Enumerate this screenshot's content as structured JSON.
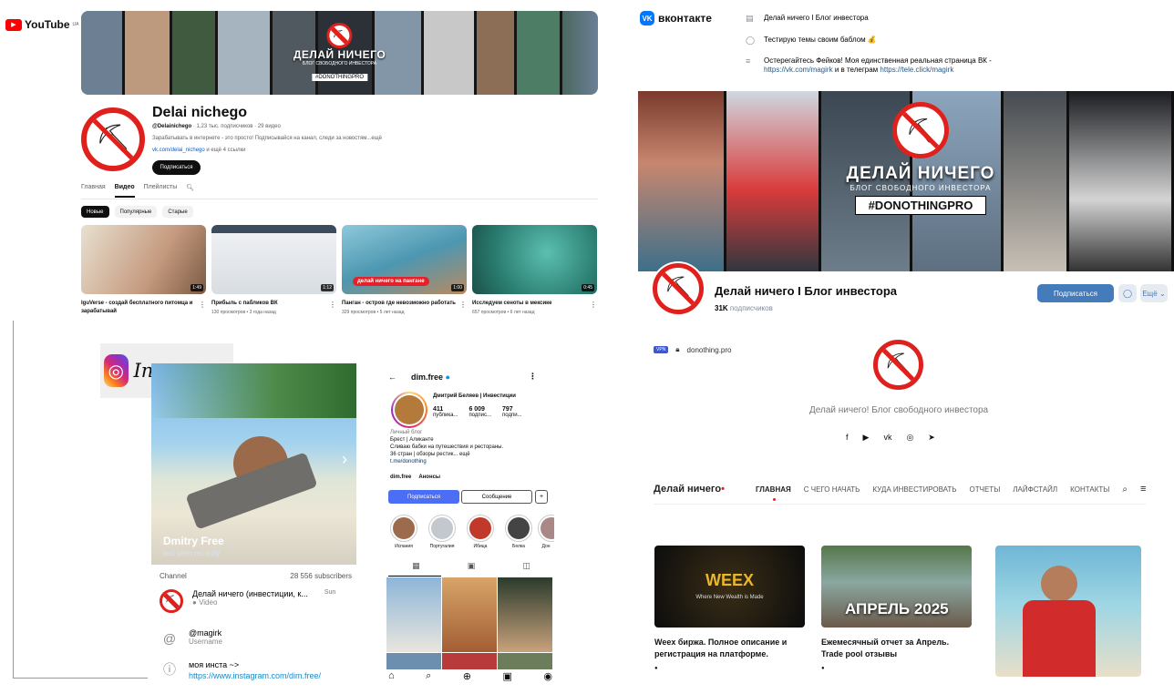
{
  "youtube": {
    "logo": "YouTube",
    "logo_suffix": "UA",
    "banner": {
      "title": "ДЕЛАЙ НИЧЕГО",
      "subtitle": "БЛОГ СВОБОДНОГО ИНВЕСТОРА",
      "tag": "#DONOTHINGPRO"
    },
    "channel_name": "Delai nichego",
    "handle": "@Delainichego",
    "meta": "1,23 тыс. подписчиков · 29 видео",
    "description": "Зарабатывать в интернете - это просто! Подписывайся на канал, следи за новостям...ещё",
    "link": "vk.com/delai_nichego",
    "link_more": "и ещё 4 ссылки",
    "subscribe": "Подписаться",
    "tabs": [
      "Главная",
      "Видео",
      "Плейлисты"
    ],
    "chips": [
      "Новые",
      "Популярные",
      "Старые"
    ],
    "videos": [
      {
        "title": "IguVerse - создай бесплатного питомца и зарабатывай",
        "meta": "",
        "duration": "1:49",
        "thumb_color": "#c9ac97"
      },
      {
        "title": "Прибыль с пабликов ВК",
        "meta": "130 просмотров • 3 года назад",
        "duration": "1:12",
        "thumb_color": "#d5d9de"
      },
      {
        "title": "Панган - остров где невозможно работать",
        "meta": "329 просмотров • 5 лет назад",
        "duration": "1:00",
        "overlay": "делай ничего на пангане",
        "thumb_color": "#5b9fb9"
      },
      {
        "title": "Исследуем сеноты в мексике",
        "meta": "657 просмотров • 6 лет назад",
        "duration": "0:45",
        "thumb_color": "#2d8a7c"
      }
    ]
  },
  "vk": {
    "logo": "вконтакте",
    "info": [
      {
        "icon": "doc-icon",
        "text": "Делай ничего I Блог инвестора"
      },
      {
        "icon": "chat-icon",
        "text": "Тестирую темы своим баблом 💰"
      },
      {
        "icon": "lines-icon",
        "text": "Остерегайтесь Фейков! Моя единственная реальная страница ВК -",
        "link1": "https://vk.com/magirk",
        "mid": "и в телеграм",
        "link2": "https://tele.click/magirk"
      }
    ],
    "cover": {
      "title": "ДЕЛАЙ НИЧЕГО",
      "subtitle": "БЛОГ СВОБОДНОГО ИНВЕСТОРА",
      "tag": "#DONOTHINGPRO"
    },
    "name": "Делай ничего I Блог инвестора",
    "subs_count": "31K",
    "subs_label": "подписчиков",
    "subscribe": "Подписаться",
    "more": "Ещё"
  },
  "instagram": {
    "logo": "Instagram"
  },
  "telegram": {
    "name": "Dmitry Free",
    "seen": "last seen recently",
    "channel_label": "Channel",
    "subscribers": "28 556 subscribers",
    "channel_title": "Делай ничего (инвестиции, к...",
    "channel_day": "Sun",
    "channel_sub": "Video",
    "username": "@magirk",
    "username_label": "Username",
    "bio_prefix": "моя инста ~> ",
    "bio_link": "https://www.instagram.com/dim.free/"
  },
  "ig_profile": {
    "username": "dim.free",
    "title": "Дмитрий Беляев | Инвестиции",
    "stats": [
      {
        "n": "411",
        "l": "публика..."
      },
      {
        "n": "6 009",
        "l": "подпис..."
      },
      {
        "n": "797",
        "l": "подпи..."
      }
    ],
    "category": "Личный блог",
    "bio": [
      "Брест | Аликанте",
      "Сливаю бабки на путешествия и рестораны.",
      "36 стран | обзоры рестик... ещё"
    ],
    "link": "t.me/donothing",
    "threads": "dim.free",
    "announce": "Анонсы",
    "btn_follow": "Подписаться",
    "btn_message": "Сообщение",
    "highlights": [
      {
        "label": "Испания",
        "color": "#9c6b4d"
      },
      {
        "label": "Португалия",
        "color": "#c3c8cf"
      },
      {
        "label": "Ибица",
        "color": "#c0392b"
      },
      {
        "label": "Белка",
        "color": "#444"
      },
      {
        "label": "Дон",
        "color": "#a88"
      }
    ]
  },
  "site": {
    "vpn": "VPN",
    "domain": "donothing.pro",
    "tagline": "Делай ничего! Блог свободного инвестора",
    "brand": "Делай ничего",
    "nav": [
      "ГЛАВНАЯ",
      "С ЧЕГО НАЧАТЬ",
      "КУДА ИНВЕСТИРОВАТЬ",
      "ОТЧЕТЫ",
      "ЛАЙФСТАЙЛ",
      "КОНТАКТЫ"
    ],
    "cards": [
      {
        "img_text": "WEEX",
        "img_sub": "Where New Wealth is Made",
        "title": "Weex биржа. Полное описание и регистрация на платформе."
      },
      {
        "img_text": "АПРЕЛЬ 2025",
        "title": "Ежемесячный отчет за Апрель. Trade pool отзывы"
      },
      {
        "title": ""
      }
    ]
  }
}
